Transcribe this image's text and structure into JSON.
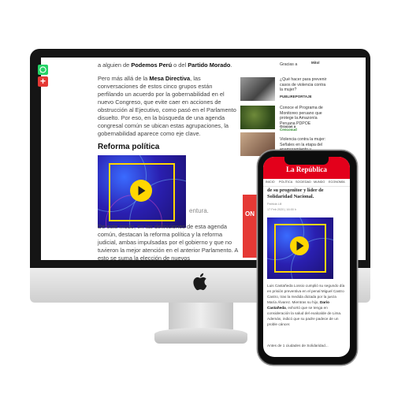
{
  "desktop": {
    "share": {
      "plus_label": "+"
    },
    "article": {
      "intro_line_bold1": "Podemos Perú",
      "intro_line_pre": "a alguien de ",
      "intro_line_mid": " o del ",
      "intro_line_bold2": "Partido Morado",
      "intro_line_end": ".",
      "p1_pre": "Pero más allá de la ",
      "p1_bold": "Mesa Directiva",
      "p1_rest": ", las conversaciones de estos cinco grupos están perfilando un acuerdo por la gobernabilidad en el nuevo Congreso, que evite caer en acciones de obstrucción al Ejecutivo, como pasó en el Parlamento disuelto. Por eso, en la búsqueda de una agenda congresal común se ubican estas agrupaciones, la gobernabilidad aparece como eje clave.",
      "heading": "Reforma política",
      "caption_rest": "entura.",
      "p2": "De este modo, en las definiciones de esta agenda común, destacan la reforma política y la reforma judicial, ambas impulsadas por el gobierno y que no tuvieron la mejor atención en el anterior Parlamento. A esto se suma la elección de nuevos"
    },
    "sidebar": {
      "items": [
        {
          "text": "Gracias a",
          "tag": "Mitol"
        },
        {
          "text": "¿Qué hacer para prevenir casos de violencia contra la mujer?",
          "tag": "PUBLIREPORTAJE"
        },
        {
          "text": "Conoce el Programa de Monitoreo peruano que protege la Amazonía Peruana PDPOE",
          "tag": "Gracias a"
        },
        {
          "text": "Violencia contra la mujer: Señales en la etapa del enamoramiento y noviazgo",
          "tag": "Cencosud"
        }
      ],
      "ad_text": "ON"
    }
  },
  "phone": {
    "logo": "La República",
    "nav": [
      "INICIO",
      "POLÍTICA",
      "SOCIEDAD",
      "MUNDO",
      "ECONOMÍA"
    ],
    "title": "de su progenitor y líder de Solidaridad Nacional.",
    "author": "Patricia Lill",
    "date": "17 Feb 2020 | 16:00 h",
    "body_pre": "Luis Castañeda Lossio cumplió su segundo día en prisión preventiva en el penal Miguel Castro Castro, tras la medida dictada por la jueza María Álvarez. Mientras su hijo, ",
    "body_bold": "Darío Castañeda",
    "body_rest": ", exhortó que se tenga en consideración la salud del exalcalde de Lima. Además, indicó que su padre padece de un proble cáncer.",
    "body_tail": "Antes de 1 ciudades de Solidaridad..."
  },
  "colors": {
    "accent_red": "#e3001b",
    "play_yellow": "#ffd600",
    "video_blue": "#2a1fb0",
    "whatsapp_green": "#25d366"
  },
  "icons": [
    "whatsapp-icon",
    "plus-icon",
    "play-icon",
    "apple-logo-icon"
  ]
}
